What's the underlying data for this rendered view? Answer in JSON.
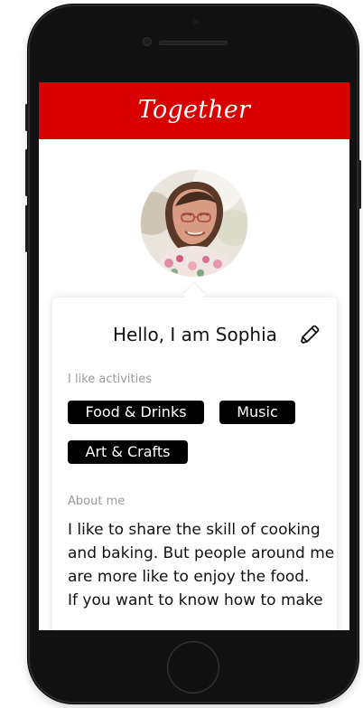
{
  "device": {
    "home_button": "home-button",
    "icons": {
      "edit": "pencil-icon"
    },
    "colors": {
      "frame": "#111111",
      "header": "#d80000",
      "chip": "#000000",
      "chip_text": "#ffffff",
      "label": "#9a9a9a"
    }
  },
  "app": {
    "title": "Together"
  },
  "profile": {
    "greeting": "Hello, I am Sophia",
    "activities_label": "I like activities",
    "activities": [
      "Food & Drinks",
      "Music",
      "Art & Crafts"
    ],
    "about_label": "About me",
    "about_lines": [
      "I like to share the skill of cooking",
      "and baking. But people around me",
      "are more like to enjoy the food.",
      "If you want to know how to make"
    ]
  }
}
